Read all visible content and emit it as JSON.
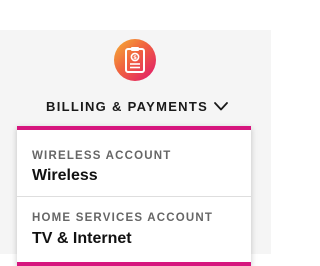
{
  "menu": {
    "icon": "billing-document-icon",
    "label": "BILLING & PAYMENTS",
    "state": "expanded",
    "accent": "#d6167e"
  },
  "dropdown": {
    "items": [
      {
        "eyebrow": "WIRELESS ACCOUNT",
        "title": "Wireless"
      },
      {
        "eyebrow": "HOME SERVICES ACCOUNT",
        "title": "TV & Internet"
      }
    ]
  }
}
